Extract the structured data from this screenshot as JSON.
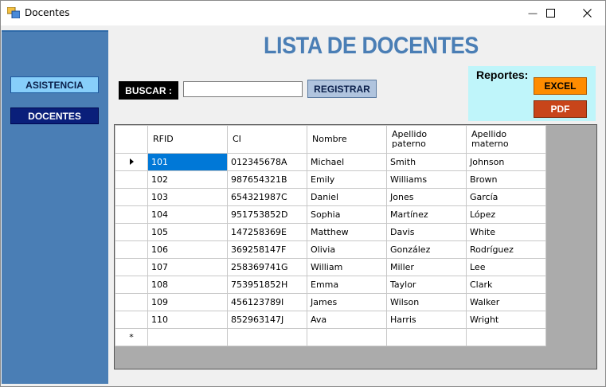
{
  "window": {
    "title": "Docentes",
    "minimize_glyph": "—",
    "maximize_glyph": "☐",
    "close_glyph": "✕"
  },
  "sidebar": {
    "asistencia_label": "ASISTENCIA",
    "docentes_label": "DOCENTES"
  },
  "header": {
    "page_title": "LISTA DE DOCENTES"
  },
  "search": {
    "label": "BUSCAR :",
    "value": "",
    "placeholder": ""
  },
  "toolbar": {
    "registrar_label": "REGISTRAR"
  },
  "reportes": {
    "label": "Reportes:",
    "excel_label": "EXCEL",
    "pdf_label": "PDF"
  },
  "table": {
    "columns": [
      "RFID",
      "CI",
      "Nombre",
      "Apellido\npaterno",
      "Apellido\nmaterno"
    ],
    "rows": [
      [
        "101",
        "012345678A",
        "Michael",
        "Smith",
        "Johnson"
      ],
      [
        "102",
        "987654321B",
        "Emily",
        "Williams",
        "Brown"
      ],
      [
        "103",
        "654321987C",
        "Daniel",
        "Jones",
        "García"
      ],
      [
        "104",
        "951753852D",
        "Sophia",
        "Martínez",
        "López"
      ],
      [
        "105",
        "147258369E",
        "Matthew",
        "Davis",
        "White"
      ],
      [
        "106",
        "369258147F",
        "Olivia",
        "González",
        "Rodríguez"
      ],
      [
        "107",
        "258369741G",
        "William",
        "Miller",
        "Lee"
      ],
      [
        "108",
        "753951852H",
        "Emma",
        "Taylor",
        "Clark"
      ],
      [
        "109",
        "456123789I",
        "James",
        "Wilson",
        "Walker"
      ],
      [
        "110",
        "852963147J",
        "Ava",
        "Harris",
        "Wright"
      ]
    ],
    "new_row_marker": "*",
    "selected_row": 0
  },
  "colors": {
    "sidebar": "#4a7eb5",
    "title": "#4a7eb5",
    "excel": "#ff8c00",
    "pdf": "#c8451a",
    "selection": "#0078d7"
  }
}
